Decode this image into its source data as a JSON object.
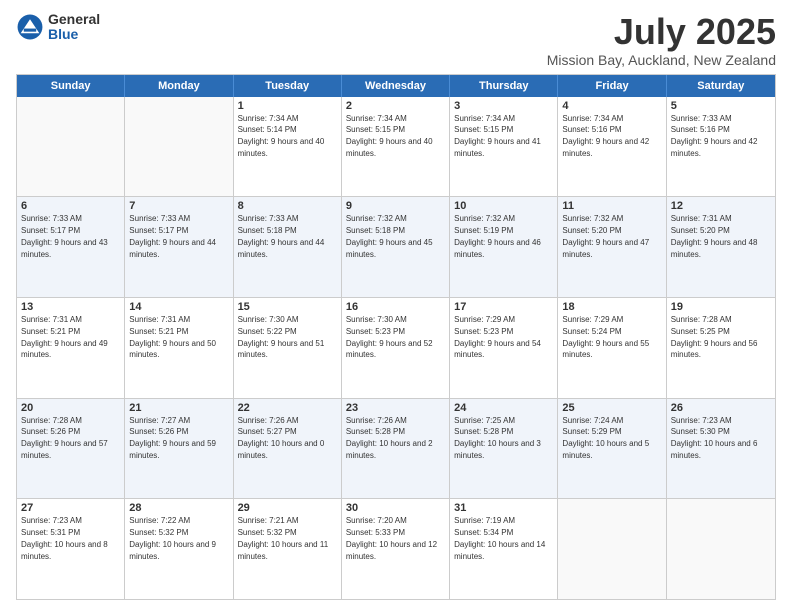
{
  "logo": {
    "general": "General",
    "blue": "Blue"
  },
  "title": "July 2025",
  "subtitle": "Mission Bay, Auckland, New Zealand",
  "days": [
    "Sunday",
    "Monday",
    "Tuesday",
    "Wednesday",
    "Thursday",
    "Friday",
    "Saturday"
  ],
  "rows": [
    [
      {
        "day": "",
        "text": ""
      },
      {
        "day": "",
        "text": ""
      },
      {
        "day": "1",
        "text": "Sunrise: 7:34 AM\nSunset: 5:14 PM\nDaylight: 9 hours and 40 minutes."
      },
      {
        "day": "2",
        "text": "Sunrise: 7:34 AM\nSunset: 5:15 PM\nDaylight: 9 hours and 40 minutes."
      },
      {
        "day": "3",
        "text": "Sunrise: 7:34 AM\nSunset: 5:15 PM\nDaylight: 9 hours and 41 minutes."
      },
      {
        "day": "4",
        "text": "Sunrise: 7:34 AM\nSunset: 5:16 PM\nDaylight: 9 hours and 42 minutes."
      },
      {
        "day": "5",
        "text": "Sunrise: 7:33 AM\nSunset: 5:16 PM\nDaylight: 9 hours and 42 minutes."
      }
    ],
    [
      {
        "day": "6",
        "text": "Sunrise: 7:33 AM\nSunset: 5:17 PM\nDaylight: 9 hours and 43 minutes."
      },
      {
        "day": "7",
        "text": "Sunrise: 7:33 AM\nSunset: 5:17 PM\nDaylight: 9 hours and 44 minutes."
      },
      {
        "day": "8",
        "text": "Sunrise: 7:33 AM\nSunset: 5:18 PM\nDaylight: 9 hours and 44 minutes."
      },
      {
        "day": "9",
        "text": "Sunrise: 7:32 AM\nSunset: 5:18 PM\nDaylight: 9 hours and 45 minutes."
      },
      {
        "day": "10",
        "text": "Sunrise: 7:32 AM\nSunset: 5:19 PM\nDaylight: 9 hours and 46 minutes."
      },
      {
        "day": "11",
        "text": "Sunrise: 7:32 AM\nSunset: 5:20 PM\nDaylight: 9 hours and 47 minutes."
      },
      {
        "day": "12",
        "text": "Sunrise: 7:31 AM\nSunset: 5:20 PM\nDaylight: 9 hours and 48 minutes."
      }
    ],
    [
      {
        "day": "13",
        "text": "Sunrise: 7:31 AM\nSunset: 5:21 PM\nDaylight: 9 hours and 49 minutes."
      },
      {
        "day": "14",
        "text": "Sunrise: 7:31 AM\nSunset: 5:21 PM\nDaylight: 9 hours and 50 minutes."
      },
      {
        "day": "15",
        "text": "Sunrise: 7:30 AM\nSunset: 5:22 PM\nDaylight: 9 hours and 51 minutes."
      },
      {
        "day": "16",
        "text": "Sunrise: 7:30 AM\nSunset: 5:23 PM\nDaylight: 9 hours and 52 minutes."
      },
      {
        "day": "17",
        "text": "Sunrise: 7:29 AM\nSunset: 5:23 PM\nDaylight: 9 hours and 54 minutes."
      },
      {
        "day": "18",
        "text": "Sunrise: 7:29 AM\nSunset: 5:24 PM\nDaylight: 9 hours and 55 minutes."
      },
      {
        "day": "19",
        "text": "Sunrise: 7:28 AM\nSunset: 5:25 PM\nDaylight: 9 hours and 56 minutes."
      }
    ],
    [
      {
        "day": "20",
        "text": "Sunrise: 7:28 AM\nSunset: 5:26 PM\nDaylight: 9 hours and 57 minutes."
      },
      {
        "day": "21",
        "text": "Sunrise: 7:27 AM\nSunset: 5:26 PM\nDaylight: 9 hours and 59 minutes."
      },
      {
        "day": "22",
        "text": "Sunrise: 7:26 AM\nSunset: 5:27 PM\nDaylight: 10 hours and 0 minutes."
      },
      {
        "day": "23",
        "text": "Sunrise: 7:26 AM\nSunset: 5:28 PM\nDaylight: 10 hours and 2 minutes."
      },
      {
        "day": "24",
        "text": "Sunrise: 7:25 AM\nSunset: 5:28 PM\nDaylight: 10 hours and 3 minutes."
      },
      {
        "day": "25",
        "text": "Sunrise: 7:24 AM\nSunset: 5:29 PM\nDaylight: 10 hours and 5 minutes."
      },
      {
        "day": "26",
        "text": "Sunrise: 7:23 AM\nSunset: 5:30 PM\nDaylight: 10 hours and 6 minutes."
      }
    ],
    [
      {
        "day": "27",
        "text": "Sunrise: 7:23 AM\nSunset: 5:31 PM\nDaylight: 10 hours and 8 minutes."
      },
      {
        "day": "28",
        "text": "Sunrise: 7:22 AM\nSunset: 5:32 PM\nDaylight: 10 hours and 9 minutes."
      },
      {
        "day": "29",
        "text": "Sunrise: 7:21 AM\nSunset: 5:32 PM\nDaylight: 10 hours and 11 minutes."
      },
      {
        "day": "30",
        "text": "Sunrise: 7:20 AM\nSunset: 5:33 PM\nDaylight: 10 hours and 12 minutes."
      },
      {
        "day": "31",
        "text": "Sunrise: 7:19 AM\nSunset: 5:34 PM\nDaylight: 10 hours and 14 minutes."
      },
      {
        "day": "",
        "text": ""
      },
      {
        "day": "",
        "text": ""
      }
    ]
  ]
}
